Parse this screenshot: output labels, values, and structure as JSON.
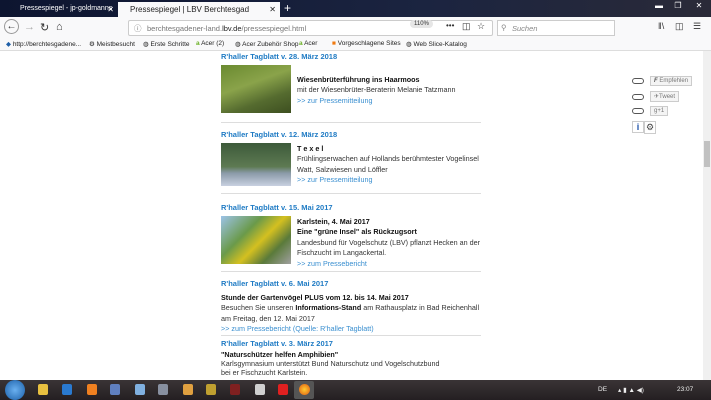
{
  "browser": {
    "tabs": [
      {
        "label": "Pressespiegel - jp-goldmanns",
        "active": false
      },
      {
        "label": "Pressespiegel | LBV Berchtesgad",
        "active": true
      }
    ],
    "url_prefix": "berchtesgadener-land.",
    "url_domain": "lbv.de",
    "url_path": "/pressespiegel.html",
    "zoom": "110%",
    "search_placeholder": "Suchen",
    "bookmarks": [
      "http://berchtesgadene...",
      "Meistbesucht",
      "Erste Schritte",
      "Acer (2)",
      "Acer Zubehör Shop",
      "Acer",
      "Vorgeschlagene Sites",
      "Web Slice-Katalog"
    ]
  },
  "entries": [
    {
      "header": "R'haller Tagblatt v. 28. März 2018",
      "title": "Wiesenbrüterführung ins Haarmoos",
      "lines": [
        "mit der Wiesenbrüter-Beraterin Melanie Tatzmann"
      ],
      "link": ">> zur Pressemitteilung"
    },
    {
      "header": "R'haller Tagblatt v. 12. März 2018",
      "title": "T e x e l",
      "lines": [
        "Frühlingserwachen auf Hollands berühmtester Vogelinsel",
        "Watt, Salzwiesen und Löffler"
      ],
      "link": ">> zur Pressemitteilung"
    },
    {
      "header": "R'haller Tagblatt v. 15. Mai 2017",
      "title": "Karlstein, 4. Mai 2017",
      "title2": "Eine \"grüne Insel\" als Rückzugsort",
      "lines": [
        "Landesbund für Vogelschutz (LBV) pflanzt Hecken an der",
        "Fischzucht im Langackertal."
      ],
      "link": ">> zum Pressebericht"
    },
    {
      "header": "R'haller Tagblatt v. 6. Mai 2017",
      "title": "Stunde der Gartenvögel PLUS vom 12. bis 14. Mai 2017",
      "line1a": "Besuchen Sie unseren ",
      "line1b": "Informations-Stand",
      "line1c": " am Rathausplatz in Bad Reichenhall",
      "line2": "am Freitag, den 12. Mai 2017",
      "link": ">> zum Pressebericht (Quelle: R'haller Tagblatt)"
    },
    {
      "header": "R'haller Tagblatt v. 3. März 2017",
      "title": "\"Naturschützer helfen Amphibien\"",
      "lines": [
        "Karlsgymnasium unterstützt Bund Naturschutz und Vogelschutzbund",
        "bei er Fischzucht Karlstein."
      ]
    }
  ],
  "social": {
    "facebook": "Empfehlen",
    "twitter": "Tweet",
    "gplus": "+1"
  },
  "taskbar": {
    "lang": "DE",
    "time": "23:07"
  }
}
